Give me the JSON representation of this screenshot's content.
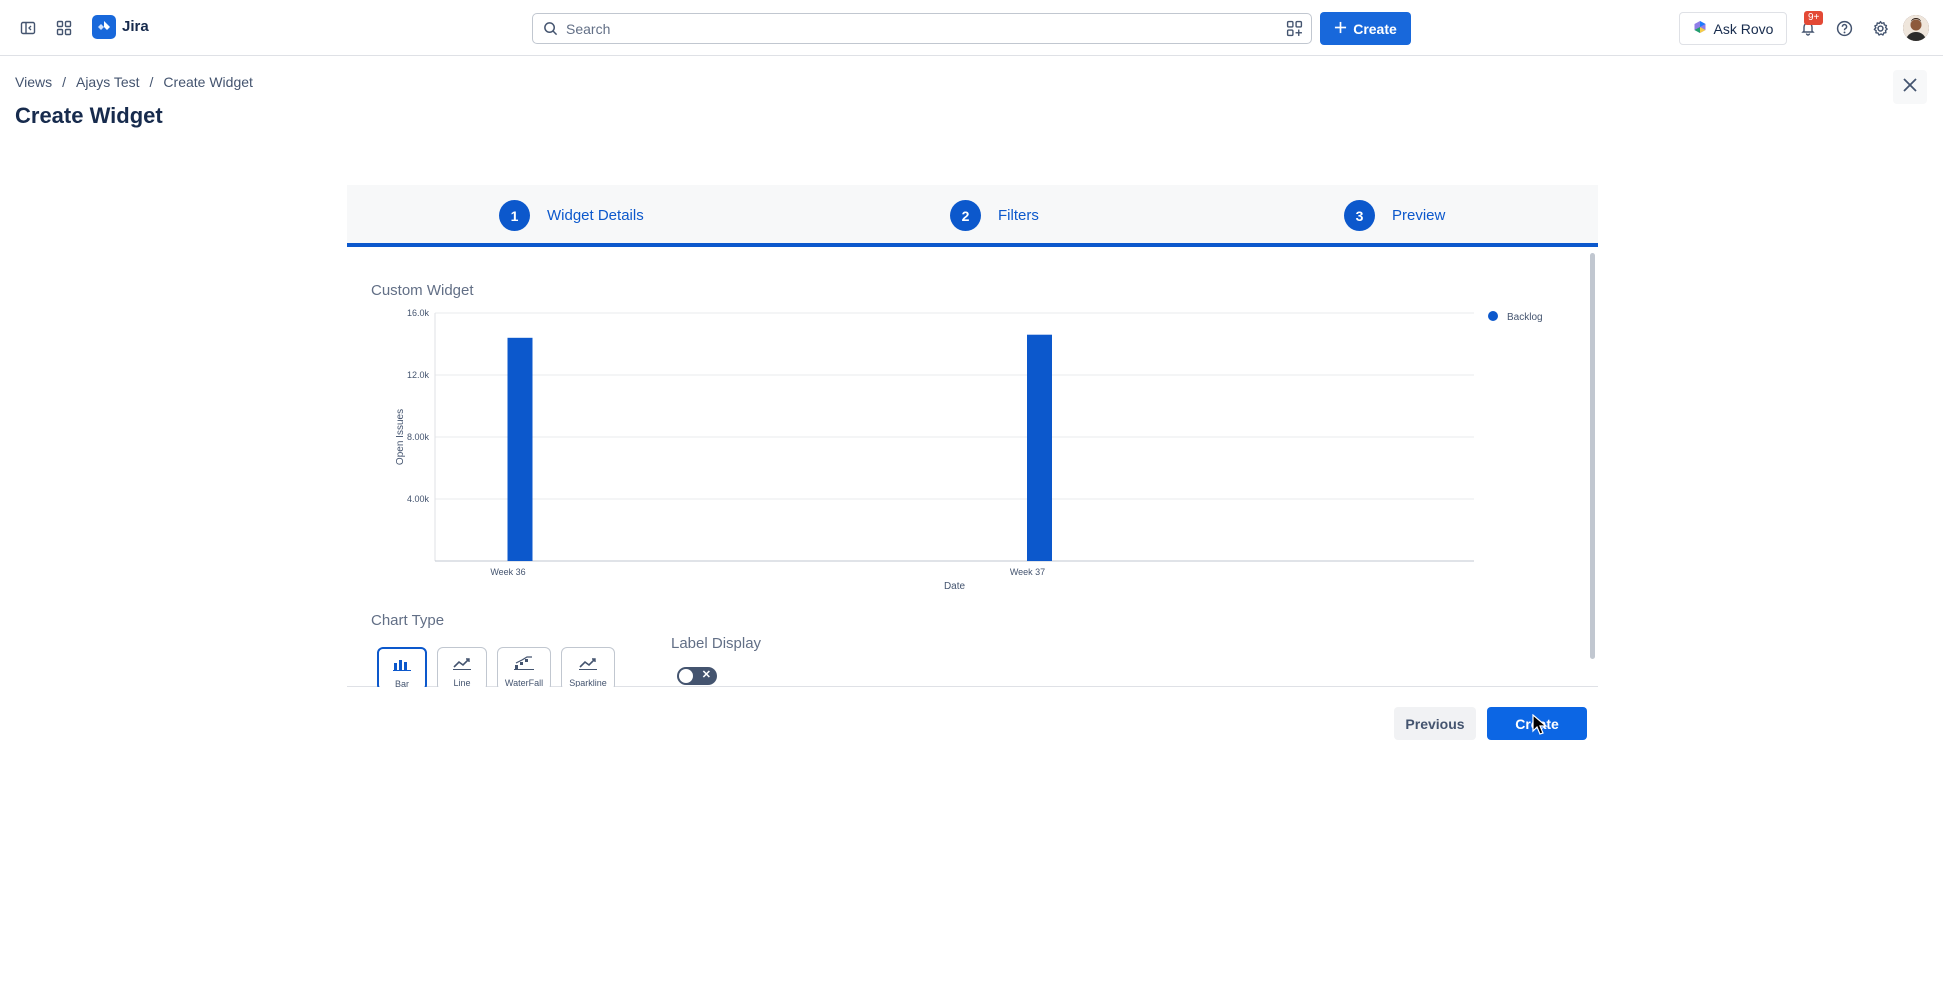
{
  "topnav": {
    "app_name": "Jira",
    "search_placeholder": "Search",
    "create_label": "Create",
    "rovo_label": "Ask Rovo",
    "notification_count": "9+",
    "icons": [
      "sidebar-toggle-icon",
      "app-switcher-icon",
      "jira-logo",
      "search-icon",
      "filter-icon",
      "plus-icon",
      "rovo-icon",
      "bell-icon",
      "help-icon",
      "gear-icon"
    ]
  },
  "header": {
    "breadcrumb": [
      "Views",
      "Ajays Test",
      "Create Widget"
    ],
    "breadcrumb_separator": "/",
    "title": "Create Widget"
  },
  "wizard": {
    "steps": [
      {
        "number": "1",
        "label": "Widget Details"
      },
      {
        "number": "2",
        "label": "Filters"
      },
      {
        "number": "3",
        "label": "Preview"
      }
    ],
    "accent_color": "#0c58cc"
  },
  "widget": {
    "title": "Custom Widget",
    "chart_type_label": "Chart Type",
    "chart_types": [
      {
        "label": "Bar",
        "icon": "bar-chart-icon",
        "selected": true
      },
      {
        "label": "Line",
        "icon": "line-chart-icon",
        "selected": false
      },
      {
        "label": "WaterFall",
        "icon": "waterfall-chart-icon",
        "selected": false
      },
      {
        "label": "Sparkline",
        "icon": "sparkline-chart-icon",
        "selected": false
      }
    ],
    "label_display_label": "Label Display",
    "label_display_on": false
  },
  "chart_data": {
    "type": "bar",
    "categories": [
      "Week 36",
      "Week 37"
    ],
    "series": [
      {
        "name": "Backlog",
        "values": [
          14400,
          14600
        ],
        "color": "#0c58cc"
      }
    ],
    "xlabel": "Date",
    "ylabel": "Open Issues",
    "ylim": [
      0,
      16000
    ],
    "yticks": [
      "4.00k",
      "8.00k",
      "12.0k",
      "16.0k"
    ],
    "grid": true,
    "legend_position": "top-right"
  },
  "footer": {
    "previous_label": "Previous",
    "create_label": "Create"
  }
}
